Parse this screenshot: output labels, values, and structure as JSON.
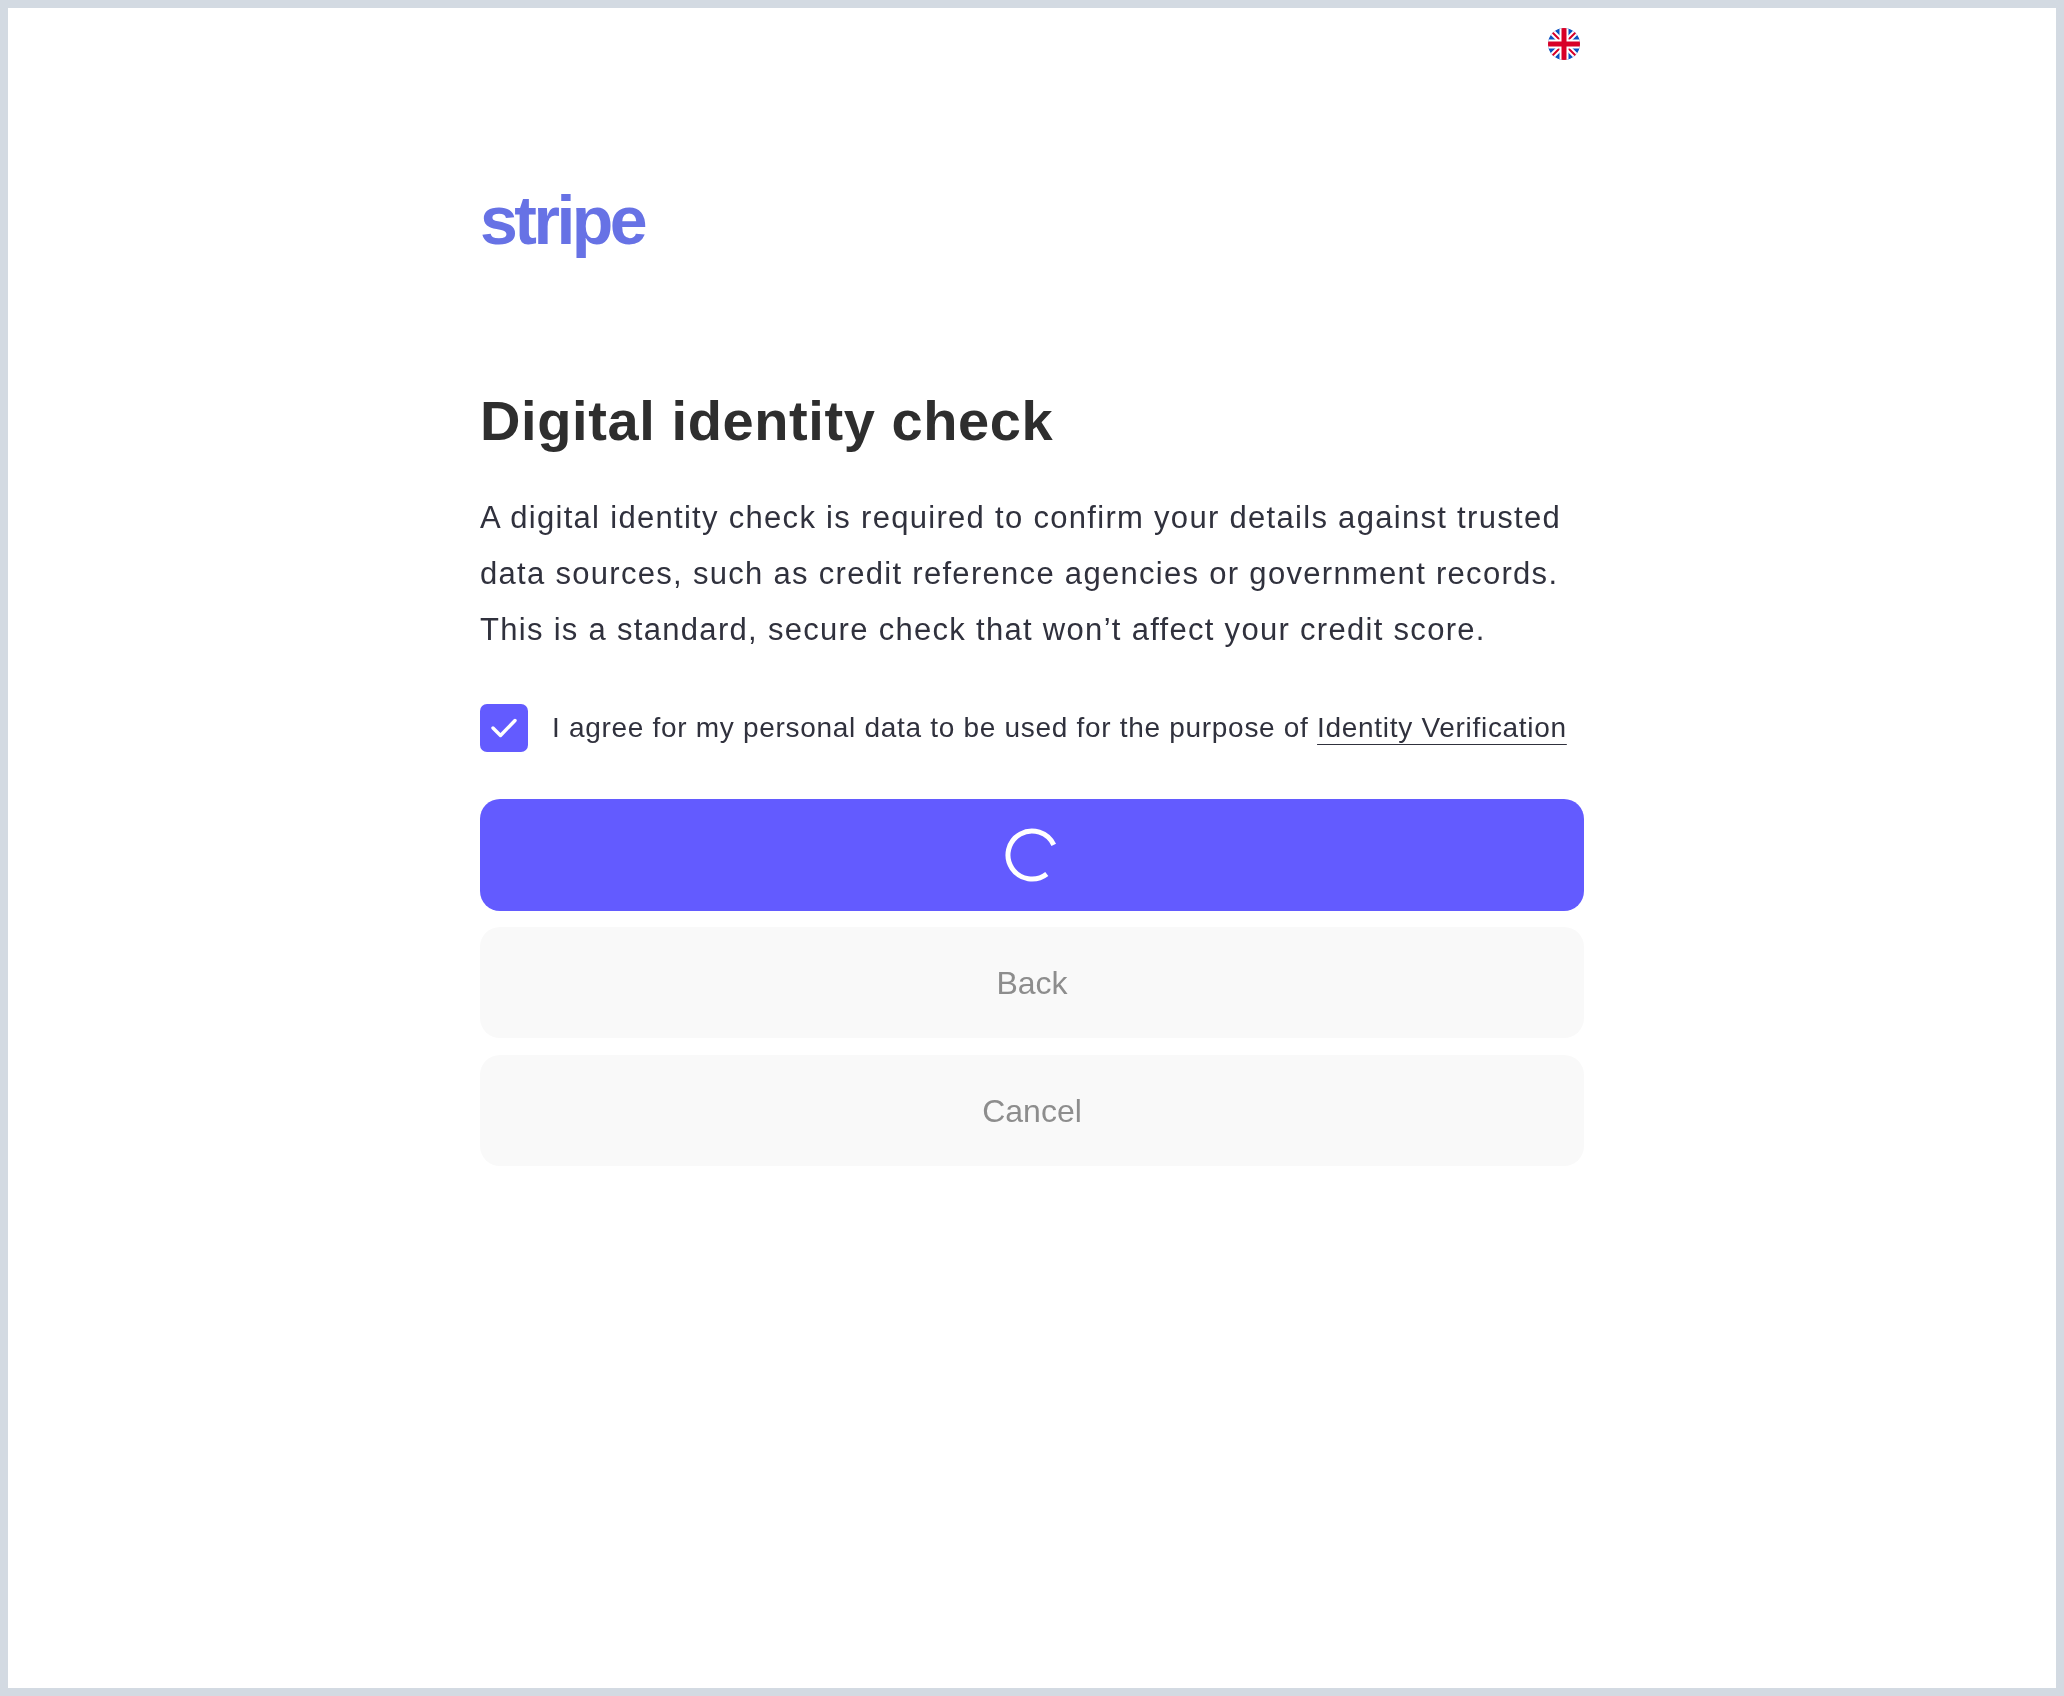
{
  "logo": {
    "text": "stripe"
  },
  "title": "Digital identity check",
  "description": "A digital identity check is required to confirm your details against trusted data sources, such as credit reference agencies or government records. This is a standard, secure check that won’t affect your credit score.",
  "consent": {
    "checked": true,
    "text": "I agree for my personal data to be used for the purpose of",
    "link": "Identity Verification"
  },
  "primary_button": {
    "loading": true
  },
  "buttons": [
    {
      "label": "Back",
      "disabled": true
    },
    {
      "label": "Cancel",
      "disabled": true
    }
  ]
}
